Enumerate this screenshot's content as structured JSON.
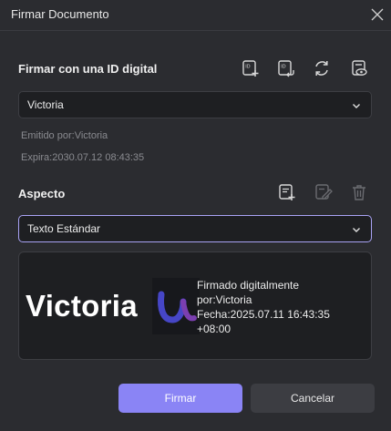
{
  "dialog": {
    "title": "Firmar Documento"
  },
  "digital_id": {
    "section_title": "Firmar con una ID digital",
    "selected": "Victoria",
    "issued_by": "Emitido por:Victoria",
    "expires": "Expira:2030.07.12 08:43:35",
    "icons": [
      "create-id-icon",
      "import-id-icon",
      "refresh-icon",
      "view-id-icon"
    ]
  },
  "appearance": {
    "section_title": "Aspecto",
    "selected": "Texto Estándar",
    "icons": [
      "create-appearance-icon",
      "edit-appearance-icon",
      "delete-appearance-icon"
    ]
  },
  "preview": {
    "name": "Victoria",
    "line1": "Firmado digitalmente",
    "line2": "por:Victoria",
    "line3": "Fecha:2025.07.11 16:43:35",
    "line4": "+08:00"
  },
  "buttons": {
    "sign": "Firmar",
    "cancel": "Cancelar"
  },
  "colors": {
    "accent": "#8a84f5",
    "background": "#2b2c30",
    "field": "#1e1f22"
  }
}
